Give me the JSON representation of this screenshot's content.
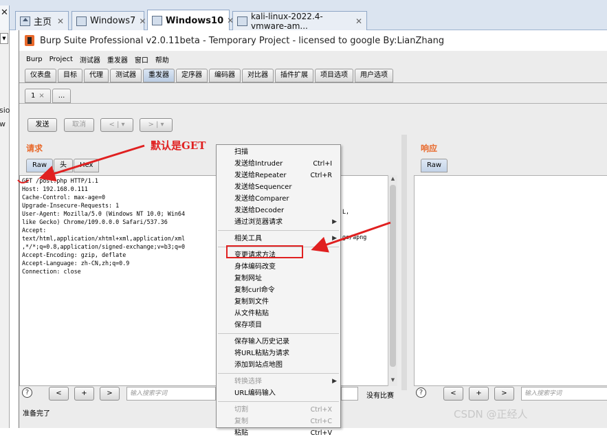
{
  "vm_tabs": [
    {
      "label": "主页",
      "icon": "home-icon"
    },
    {
      "label": "Windows7",
      "icon": "vm-icon"
    },
    {
      "label": "Windows10",
      "icon": "vm-icon"
    },
    {
      "label": "kali-linux-2022.4-vmware-am...",
      "icon": "vm-icon"
    }
  ],
  "left_strip": {
    "frag1": "sio",
    "frag2": "w"
  },
  "window_title": "Burp Suite Professional v2.0.11beta - Temporary Project - licensed to google By:LianZhang",
  "menu": [
    "Burp",
    "Project",
    "测试器",
    "重发器",
    "窗口",
    "帮助"
  ],
  "tool_tabs": [
    "仪表盘",
    "目标",
    "代理",
    "测试器",
    "重发器",
    "定序器",
    "编码器",
    "对比器",
    "插件扩展",
    "项目选项",
    "用户选项"
  ],
  "active_tool_tab": "重发器",
  "sub_tabs": {
    "tab1": "1",
    "tab1_close": "×",
    "more": "..."
  },
  "controls": {
    "send": "发送",
    "cancel": "取消",
    "prev": "< | ▾",
    "next": "> | ▾"
  },
  "request": {
    "header": "请求",
    "tabs": [
      "Raw",
      "头",
      "Hex"
    ],
    "lines": [
      "GET /post.php HTTP/1.1",
      "Host: 192.168.0.111",
      "Cache-Control: max-age=0",
      "Upgrade-Insecure-Requests: 1",
      "User-Agent: Mozilla/5.0 (Windows NT 10.0; Win64",
      "like Gecko) Chrome/109.0.0.0 Safari/537.36",
      "Accept:",
      "text/html,application/xhtml+xml,application/xml",
      ",*/*;q=0.8,application/signed-exchange;v=b3;q=0",
      "Accept-Encoding: gzip, deflate",
      "Accept-Language: zh-CN,zh;q=0.9",
      "Connection: close"
    ],
    "overflow_right_1": "L,",
    "overflow_right_2": "ge/apng"
  },
  "response": {
    "header": "响应",
    "tabs": [
      "Raw"
    ]
  },
  "bottom_left": {
    "help": "?",
    "prev": "<",
    "add": "+",
    "next": ">",
    "search_placeholder": "输入搜索字词",
    "matches": "没有比赛"
  },
  "bottom_right": {
    "help": "?",
    "prev": "<",
    "add": "+",
    "next": ">",
    "search_placeholder": "输入搜索字词"
  },
  "status": "准备完了",
  "context_menu": {
    "items": [
      {
        "label": "扫描",
        "accel": "",
        "submenu": false,
        "disabled": false
      },
      {
        "label": "发送给Intruder",
        "accel": "Ctrl+I",
        "submenu": false,
        "disabled": false
      },
      {
        "label": "发送给Repeater",
        "accel": "Ctrl+R",
        "submenu": false,
        "disabled": false
      },
      {
        "label": "发送给Sequencer",
        "accel": "",
        "submenu": false,
        "disabled": false
      },
      {
        "label": "发送给Comparer",
        "accel": "",
        "submenu": false,
        "disabled": false
      },
      {
        "label": "发送给Decoder",
        "accel": "",
        "submenu": false,
        "disabled": false
      },
      {
        "label": "通过浏览器请求",
        "accel": "",
        "submenu": true,
        "disabled": false
      },
      {
        "label": "相关工具",
        "accel": "",
        "submenu": true,
        "disabled": false
      },
      {
        "label": "变更请求方法",
        "accel": "",
        "submenu": false,
        "disabled": false
      },
      {
        "label": "身体编码改变",
        "accel": "",
        "submenu": false,
        "disabled": false
      },
      {
        "label": "复制网址",
        "accel": "",
        "submenu": false,
        "disabled": false
      },
      {
        "label": "复制curl命令",
        "accel": "",
        "submenu": false,
        "disabled": false
      },
      {
        "label": "复制到文件",
        "accel": "",
        "submenu": false,
        "disabled": false
      },
      {
        "label": "从文件粘贴",
        "accel": "",
        "submenu": false,
        "disabled": false
      },
      {
        "label": "保存项目",
        "accel": "",
        "submenu": false,
        "disabled": false
      },
      {
        "label": "保存输入历史记录",
        "accel": "",
        "submenu": false,
        "disabled": false
      },
      {
        "label": "将URL粘贴为请求",
        "accel": "",
        "submenu": false,
        "disabled": false
      },
      {
        "label": "添加到站点地图",
        "accel": "",
        "submenu": false,
        "disabled": false
      },
      {
        "label": "转换选择",
        "accel": "",
        "submenu": true,
        "disabled": true
      },
      {
        "label": "URL编码输入",
        "accel": "",
        "submenu": false,
        "disabled": false
      },
      {
        "label": "切割",
        "accel": "Ctrl+X",
        "submenu": false,
        "disabled": true
      },
      {
        "label": "复制",
        "accel": "Ctrl+C",
        "submenu": false,
        "disabled": true
      },
      {
        "label": "粘贴",
        "accel": "Ctrl+V",
        "submenu": false,
        "disabled": false
      }
    ]
  },
  "annotation": {
    "text": "默认是GET",
    "color": "#e02020"
  },
  "watermark": "CSDN @正经人",
  "colors": {
    "accent": "#e8692b",
    "annotation": "#e02020"
  }
}
